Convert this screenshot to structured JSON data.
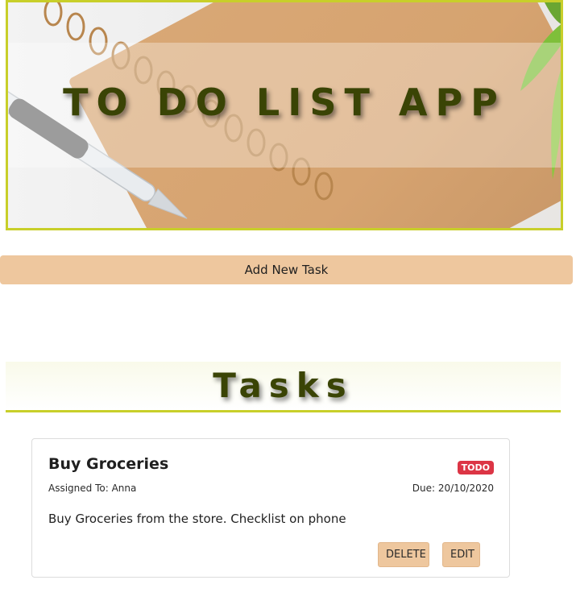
{
  "hero": {
    "title": "TO DO LIST APP"
  },
  "actions": {
    "add_task_label": "Add New Task"
  },
  "tasks_section": {
    "title": "Tasks"
  },
  "tasks": [
    {
      "name": "Buy Groceries",
      "status": "TODO",
      "assigned": "Assigned To: Anna",
      "due": "Due: 20/10/2020",
      "description": "Buy Groceries from the store. Checklist on phone",
      "delete_label": "DELETE",
      "edit_label": "EDIT"
    }
  ],
  "colors": {
    "accent_border": "#c8cf2a",
    "button_bg": "#eec79e",
    "title_color": "#3a4405",
    "badge_red": "#dc3545"
  }
}
